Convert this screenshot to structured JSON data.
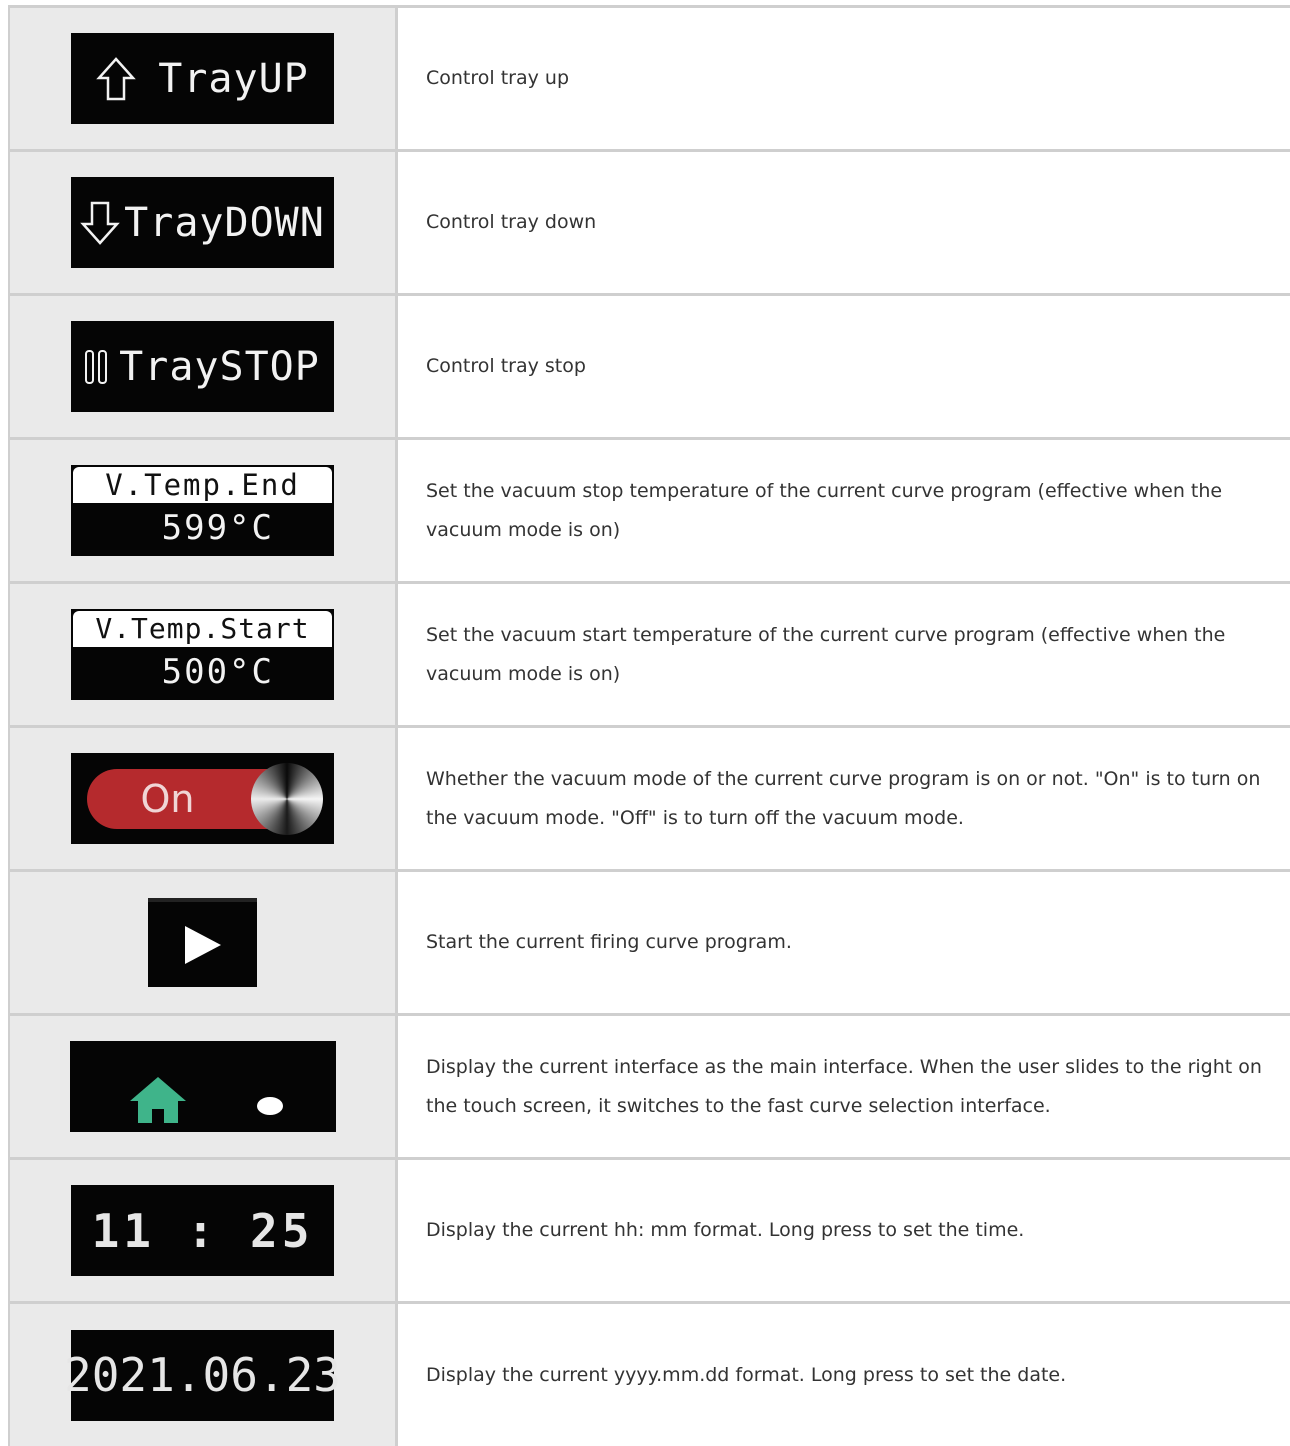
{
  "rows": [
    {
      "icon_text": "TrayUP",
      "desc": "Control tray up"
    },
    {
      "icon_text": "TrayDOWN",
      "desc": "Control tray down"
    },
    {
      "icon_text": "TraySTOP",
      "desc": "Control tray stop"
    },
    {
      "icon_label": "V.Temp.End",
      "icon_value": "599°C",
      "desc": "Set the vacuum stop temperature of the current curve program (effective when the vacuum mode is on)"
    },
    {
      "icon_label": "V.Temp.Start",
      "icon_value": "500°C",
      "desc": "Set the vacuum start temperature of the current curve program (effective when the vacuum mode is on)"
    },
    {
      "icon_text": "On",
      "desc": "Whether the vacuum mode of the current curve program is on or not.  \"On\" is to turn on the vacuum mode. \"Off\" is to turn off the vacuum mode."
    },
    {
      "desc": "Start the current firing curve program."
    },
    {
      "desc": "Display the current interface as the main interface. When the user slides to the right on the touch screen, it switches to the fast curve selection interface."
    },
    {
      "icon_text": "11 : 25",
      "desc": "Display the current hh: mm format. Long press to set the time."
    },
    {
      "icon_text": "2021.06.23",
      "desc": "Display the current yyyy.mm.dd format. Long press to set the date."
    }
  ],
  "colors": {
    "toggle_on": "#b52a2d",
    "home_icon": "#3fb48a",
    "icon_bg": "#050505",
    "label_column_bg": "#eaeaea"
  },
  "icons": {
    "up": "arrow-up-outline-icon",
    "down": "arrow-down-outline-icon",
    "stop": "pause-outline-icon",
    "play": "play-icon",
    "home": "home-icon"
  }
}
